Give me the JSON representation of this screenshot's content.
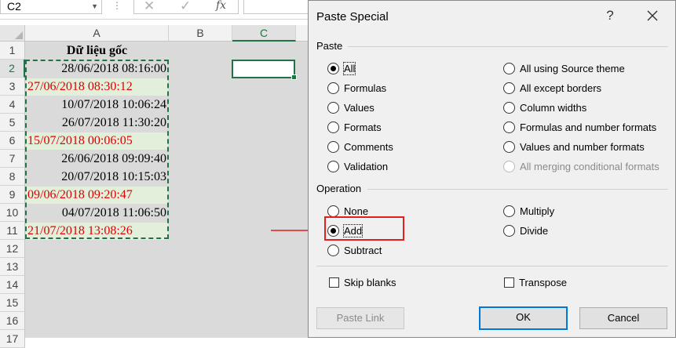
{
  "formula_bar": {
    "name_box": "C2",
    "name_box_dropdown_icon": "chevron-down-icon",
    "dots": "⋮",
    "cancel_icon": "✕",
    "enter_icon": "✓",
    "fx_label": "fx",
    "formula_value": ""
  },
  "sheet": {
    "columns": [
      "A",
      "B",
      "C"
    ],
    "selected_column": "C",
    "rows": [
      "1",
      "2",
      "3",
      "4",
      "5",
      "6",
      "7",
      "8",
      "9",
      "10",
      "11",
      "12",
      "13",
      "14",
      "15",
      "16",
      "17"
    ],
    "selected_row": "2",
    "header_cell": "Dữ liệu gốc",
    "values": [
      "28/06/2018 08:16:00",
      "27/06/2018 08:30:12",
      "10/07/2018 10:06:24",
      "26/07/2018 11:30:20",
      "15/07/2018 00:06:05",
      "26/06/2018 09:09:40",
      "20/07/2018 10:15:03",
      "09/06/2018 09:20:47",
      "04/07/2018 11:06:50",
      "21/07/2018 13:08:26"
    ],
    "text_value_color": "#e00000",
    "text_value_fill": "#e2efda",
    "active_cell": "C2"
  },
  "dialog": {
    "title": "Paste Special",
    "help_label": "?",
    "close_icon": "close-icon",
    "paste_section": "Paste",
    "paste_options": {
      "all": "All",
      "formulas": "Formulas",
      "values": "Values",
      "formats": "Formats",
      "comments": "Comments",
      "validation": "Validation",
      "all_source_theme": "All using Source theme",
      "all_except_borders": "All except borders",
      "column_widths": "Column widths",
      "formulas_number_formats": "Formulas and number formats",
      "values_number_formats": "Values and number formats",
      "all_merging": "All merging conditional formats"
    },
    "paste_selected": "All",
    "operation_section": "Operation",
    "operation_options": {
      "none": "None",
      "add": "Add",
      "subtract": "Subtract",
      "multiply": "Multiply",
      "divide": "Divide"
    },
    "operation_selected": "Add",
    "skip_blanks": "Skip blanks",
    "transpose": "Transpose",
    "paste_link_button": "Paste Link",
    "ok_button": "OK",
    "cancel_button": "Cancel",
    "accent_color": "#0078d7",
    "highlight_color": "#e0201e"
  }
}
